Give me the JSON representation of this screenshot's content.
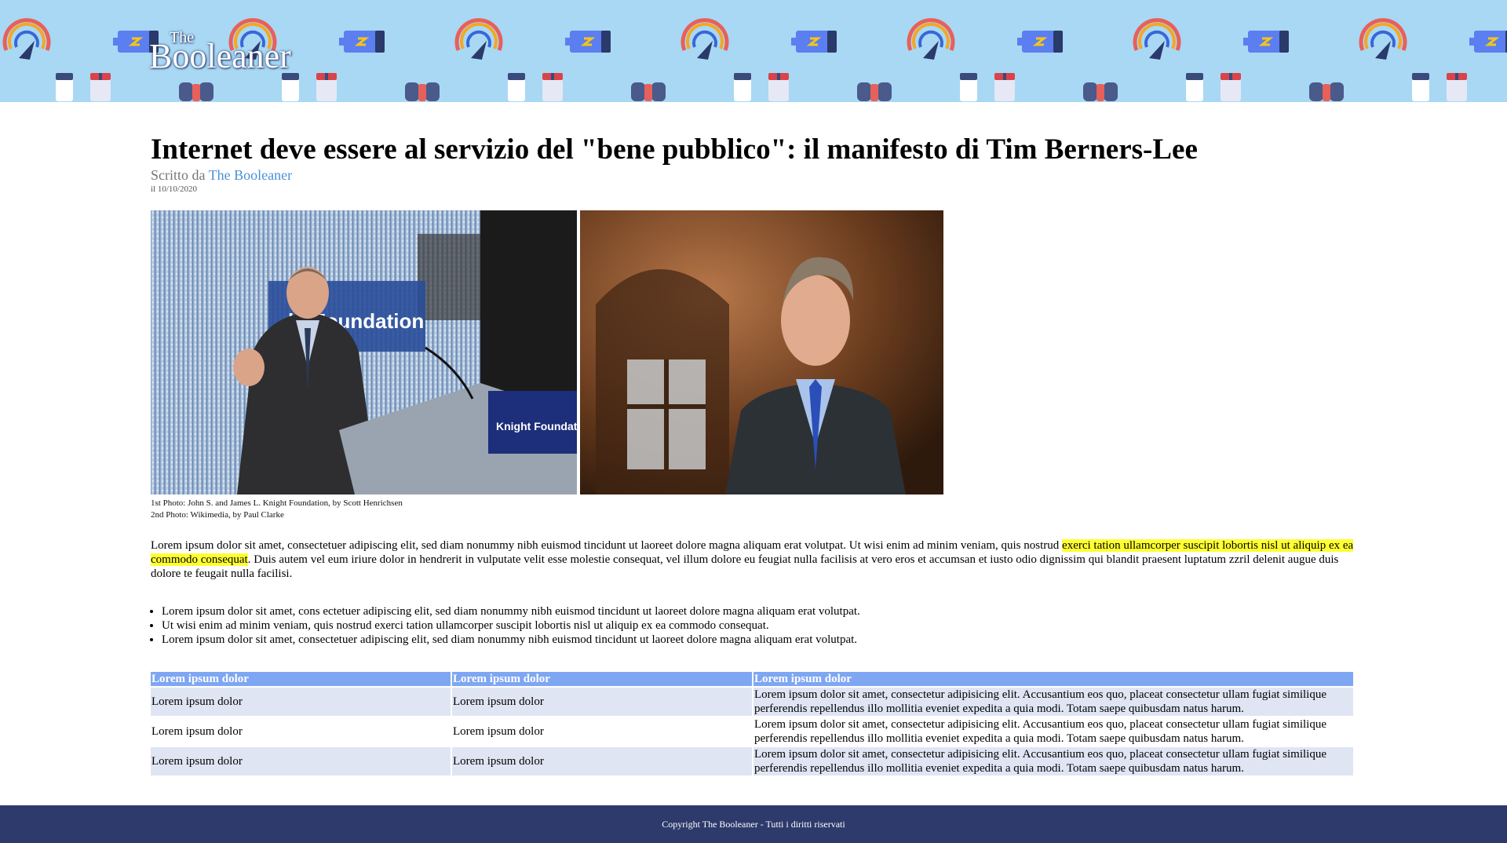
{
  "header": {
    "logo_the": "The",
    "logo_name": "Booleaner"
  },
  "article": {
    "title": "Internet deve essere al servizio del \"bene pubblico\": il manifesto di Tim Berners-Lee",
    "byline_prefix": "Scritto da",
    "author": "The Booleaner",
    "date": "il 10/10/2020",
    "photo1_banner_text": "ht Foundation",
    "photo1_podium_text": "Knight Foundation",
    "caption_line1": "1st Photo: John S. and James L. Knight Foundation, by Scott Henrichsen",
    "caption_line2": "2nd Photo: Wikimedia, by Paul Clarke",
    "paragraph_part1": "Lorem ipsum dolor sit amet, consectetuer adipiscing elit, sed diam nonummy nibh euismod tincidunt ut laoreet dolore magna aliquam erat volutpat. Ut wisi enim ad minim veniam, quis nostrud ",
    "paragraph_highlight": "exerci tation ullamcorper suscipit lobortis nisl ut aliquip ex ea commodo consequat",
    "paragraph_part2": ". Duis autem vel eum iriure dolor in hendrerit in vulputate velit esse molestie consequat, vel illum dolore eu feugiat nulla facilisis at vero eros et accumsan et iusto odio dignissim qui blandit praesent luptatum zzril delenit augue duis dolore te feugait nulla facilisi.",
    "bullets": [
      "Lorem ipsum dolor sit amet, cons ectetuer adipiscing elit, sed diam nonummy nibh euismod tincidunt ut laoreet dolore magna aliquam erat volutpat.",
      "Ut wisi enim ad minim veniam, quis nostrud exerci tation ullamcorper suscipit lobortis nisl ut aliquip ex ea commodo consequat.",
      "Lorem ipsum dolor sit amet, consectetuer adipiscing elit, sed diam nonummy nibh euismod tincidunt ut laoreet dolore magna aliquam erat volutpat."
    ],
    "table": {
      "headers": [
        "Lorem ipsum dolor",
        "Lorem ipsum dolor",
        "Lorem ipsum dolor"
      ],
      "rows": [
        [
          "Lorem ipsum dolor",
          "Lorem ipsum dolor",
          "Lorem ipsum dolor sit amet, consectetur adipisicing elit. Accusantium eos quo, placeat consectetur ullam fugiat similique perferendis repellendus illo mollitia eveniet expedita a quia modi. Totam saepe quibusdam natus harum."
        ],
        [
          "Lorem ipsum dolor",
          "Lorem ipsum dolor",
          "Lorem ipsum dolor sit amet, consectetur adipisicing elit. Accusantium eos quo, placeat consectetur ullam fugiat similique perferendis repellendus illo mollitia eveniet expedita a quia modi. Totam saepe quibusdam natus harum."
        ],
        [
          "Lorem ipsum dolor",
          "Lorem ipsum dolor",
          "Lorem ipsum dolor sit amet, consectetur adipisicing elit. Accusantium eos quo, placeat consectetur ullam fugiat similique perferendis repellendus illo mollitia eveniet expedita a quia modi. Totam saepe quibusdam natus harum."
        ]
      ]
    }
  },
  "footer": {
    "copyright": "Copyright The Booleaner - Tutti i diritti riservati"
  },
  "colors": {
    "banner_bg": "#a8d8f4",
    "link": "#4a90d9",
    "highlight": "#ffff33",
    "table_header": "#7ea6f2",
    "table_alt_row": "#dfe5f3",
    "footer_bg": "#2d3a6b"
  },
  "icons": [
    "gauge-icon",
    "battery-icon",
    "bowtie-icon",
    "cup-icon"
  ]
}
